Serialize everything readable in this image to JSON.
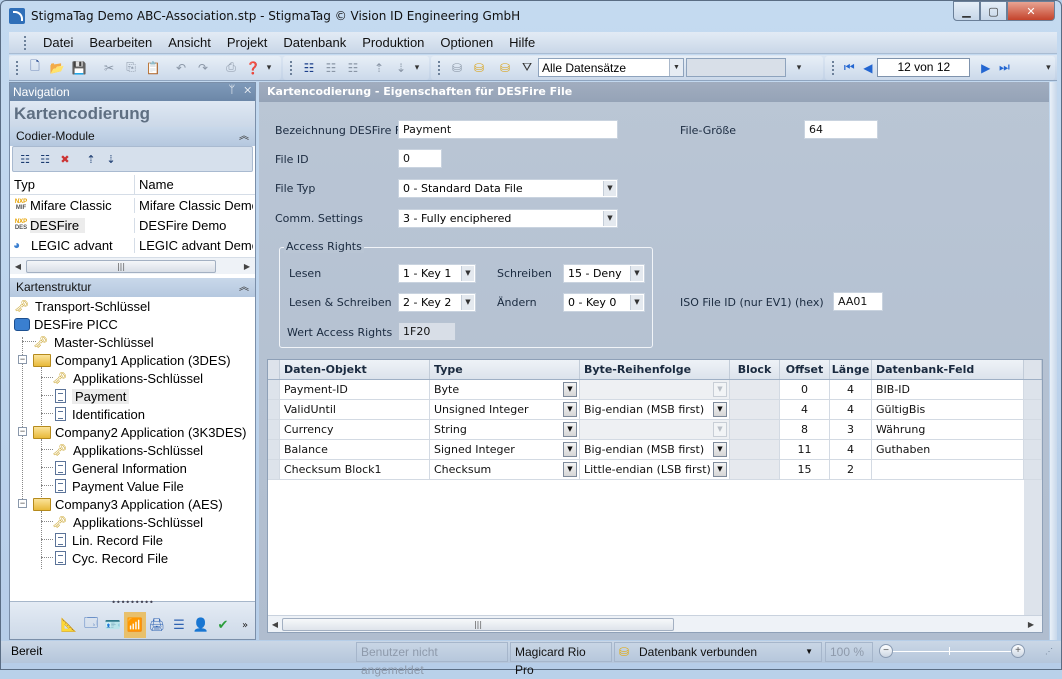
{
  "window": {
    "title": "StigmaTag Demo ABC-Association.stp - StigmaTag   © Vision ID Engineering GmbH",
    "minimize": "▁",
    "maximize": "▢",
    "close": "✕"
  },
  "menu": [
    {
      "label": "Datei"
    },
    {
      "label": "Bearbeiten"
    },
    {
      "label": "Ansicht"
    },
    {
      "label": "Projekt"
    },
    {
      "label": "Datenbank"
    },
    {
      "label": "Produktion"
    },
    {
      "label": "Optionen"
    },
    {
      "label": "Hilfe"
    }
  ],
  "toolbar": {
    "filter_value": "Alle Datensätze",
    "record_position": "12 von 12"
  },
  "navigation": {
    "panel_title": "Navigation",
    "pin": "ᛘ",
    "close": "✕",
    "section_title": "Kartencodierung",
    "modules_header": "Codier-Module",
    "collapse_glyph": "︽",
    "list_columns": [
      "Typ",
      "Name"
    ],
    "modules": [
      {
        "chip_top": "NXP",
        "chip_bottom": "MIF",
        "type": "Mifare Classic",
        "name": "Mifare Classic Demo"
      },
      {
        "chip_top": "NXP",
        "chip_bottom": "DES",
        "type": "DESFire",
        "name": "DESFire Demo"
      },
      {
        "chip_top": "",
        "chip_bottom": "",
        "type": "LEGIC advant",
        "name": "LEGIC advant Demo"
      }
    ],
    "structure_header": "Kartenstruktur",
    "tree": [
      {
        "label": "Transport-Schlüssel",
        "icon": "key"
      },
      {
        "label": "DESFire PICC",
        "icon": "picc"
      },
      {
        "label": "Master-Schlüssel",
        "icon": "key"
      },
      {
        "label": "Company1 Application (3DES)",
        "icon": "folder"
      },
      {
        "label": "Applikations-Schlüssel",
        "icon": "key"
      },
      {
        "label": "Payment",
        "icon": "file",
        "selected": true
      },
      {
        "label": "Identification",
        "icon": "file"
      },
      {
        "label": "Company2 Application (3K3DES)",
        "icon": "folder"
      },
      {
        "label": "Applikations-Schlüssel",
        "icon": "key"
      },
      {
        "label": "General Information",
        "icon": "file"
      },
      {
        "label": "Payment Value File",
        "icon": "file"
      },
      {
        "label": "Company3 Application (AES)",
        "icon": "folder"
      },
      {
        "label": "Applikations-Schlüssel",
        "icon": "key"
      },
      {
        "label": "Lin. Record File",
        "icon": "file"
      },
      {
        "label": "Cyc. Record File",
        "icon": "file"
      }
    ]
  },
  "main": {
    "header": "Kartencodierung - Eigenschaften für DESFire File",
    "fields": {
      "name_label": "Bezeichnung DESFire File",
      "name_value": "Payment",
      "file_id_label": "File ID",
      "file_id_value": "0",
      "file_type_label": "File Typ",
      "file_type_value": "0 - Standard Data File",
      "comm_label": "Comm. Settings",
      "comm_value": "3 - Fully enciphered",
      "size_label": "File-Größe",
      "size_value": "64",
      "iso_label": "ISO File ID (nur EV1) (hex)",
      "iso_value": "AA01"
    },
    "access": {
      "title": "Access Rights",
      "read_label": "Lesen",
      "read_value": "1 - Key 1",
      "write_label": "Schreiben",
      "write_value": "15 - Deny",
      "readwrite_label": "Lesen & Schreiben",
      "readwrite_value": "2 - Key 2",
      "change_label": "Ändern",
      "change_value": "0 - Key 0",
      "value_label": "Wert Access Rights",
      "value_value": "1F20"
    },
    "grid": {
      "columns": [
        "Daten-Objekt",
        "Type",
        "Byte-Reihenfolge",
        "Block",
        "Offset",
        "Länge",
        "Datenbank-Feld"
      ],
      "rows": [
        {
          "object": "Payment-ID",
          "type": "Byte",
          "order": "",
          "order_enabled": false,
          "block": "",
          "offset": "0",
          "length": "4",
          "db_field": "BIB-ID"
        },
        {
          "object": "ValidUntil",
          "type": "Unsigned Integer",
          "order": "Big-endian (MSB first)",
          "order_enabled": true,
          "block": "",
          "offset": "4",
          "length": "4",
          "db_field": "GültigBis"
        },
        {
          "object": "Currency",
          "type": "String",
          "order": "",
          "order_enabled": false,
          "block": "",
          "offset": "8",
          "length": "3",
          "db_field": "Währung"
        },
        {
          "object": "Balance",
          "type": "Signed Integer",
          "order": "Big-endian (MSB first)",
          "order_enabled": true,
          "block": "",
          "offset": "11",
          "length": "4",
          "db_field": "Guthaben"
        },
        {
          "object": "Checksum Block1",
          "type": "Checksum",
          "order": "Little-endian (LSB first)",
          "order_enabled": true,
          "block": "",
          "offset": "15",
          "length": "2",
          "db_field": ""
        }
      ]
    }
  },
  "status": {
    "ready": "Bereit",
    "user": "Benutzer nicht angemeldet",
    "printer": "Magicard Rio Pro",
    "database": "Datenbank verbunden",
    "zoom": "100 %"
  },
  "colors": {
    "title_bg": "#c4daf0",
    "panel_header": "#7f9ab9",
    "main_bg": "#b9c5d4",
    "active_tool": "#e8c06b",
    "nav_blue": "#2366d1"
  }
}
